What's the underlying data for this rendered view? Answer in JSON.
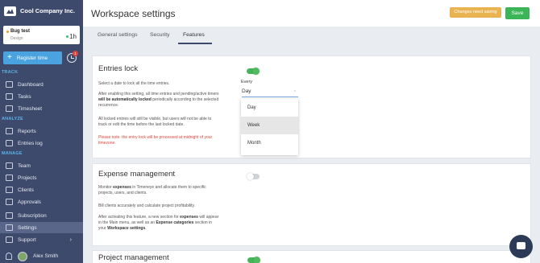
{
  "sidebar": {
    "company": "Cool Company Inc.",
    "timer": {
      "title": "Bug test",
      "subtitle": "Design",
      "time": "1h"
    },
    "register_label": "Register time",
    "notifications_count": "1",
    "sections": {
      "track": "TRACK",
      "analyze": "ANALYZE",
      "manage": "MANAGE"
    },
    "items": [
      {
        "label": "Dashboard",
        "icon": "dashboard-icon"
      },
      {
        "label": "Tasks",
        "icon": "tasks-icon"
      },
      {
        "label": "Timesheet",
        "icon": "timesheet-icon"
      },
      {
        "label": "Reports",
        "icon": "reports-icon"
      },
      {
        "label": "Entries log",
        "icon": "entries-log-icon"
      },
      {
        "label": "Team",
        "icon": "team-icon"
      },
      {
        "label": "Projects",
        "icon": "projects-icon"
      },
      {
        "label": "Clients",
        "icon": "clients-icon"
      },
      {
        "label": "Approvals",
        "icon": "approvals-icon"
      },
      {
        "label": "Subscription",
        "icon": "subscription-icon"
      },
      {
        "label": "Settings",
        "icon": "gear-icon"
      },
      {
        "label": "Support",
        "icon": "support-icon"
      }
    ],
    "user": "Alex Smith"
  },
  "header": {
    "title": "Workspace settings",
    "unsaved_label": "Changes need saving",
    "save_label": "Save"
  },
  "tabs": [
    "General settings",
    "Security",
    "Features"
  ],
  "entries_lock": {
    "title": "Entries lock",
    "p1": "Select a date to lock all the time entries.",
    "p2_a": "After enabling this setting, all time entries and pending/active timers ",
    "p2_b": "will be automatically locked",
    "p2_c": " periodically according to the selected recurrence.",
    "p3": "All locked entries will still be visible, but users will not be able to track or edit the time before the last locked date.",
    "warning": "Please note: the entry lock will be processed at midnight of your timezone.",
    "every_label": "Every",
    "selected": "Day",
    "options": [
      "Day",
      "Week",
      "Month"
    ],
    "enabled": true
  },
  "expense": {
    "title": "Expense management",
    "p1_a": "Monitor ",
    "p1_b": "expenses",
    "p1_c": " in Timeneye and allocate them to specific projects, users, and clients.",
    "p2": "Bill clients accurately and calculate project profitability.",
    "p3_a": "After activating this feature, a new section for ",
    "p3_b": "expenses",
    "p3_c": " will appear in the Main menu, as well as an ",
    "p3_d": "Expense categories",
    "p3_e": " section in your ",
    "p3_f": "Workspace settings",
    "p3_g": ".",
    "enabled": false
  },
  "project_mgmt": {
    "title": "Project management",
    "enabled": true
  }
}
